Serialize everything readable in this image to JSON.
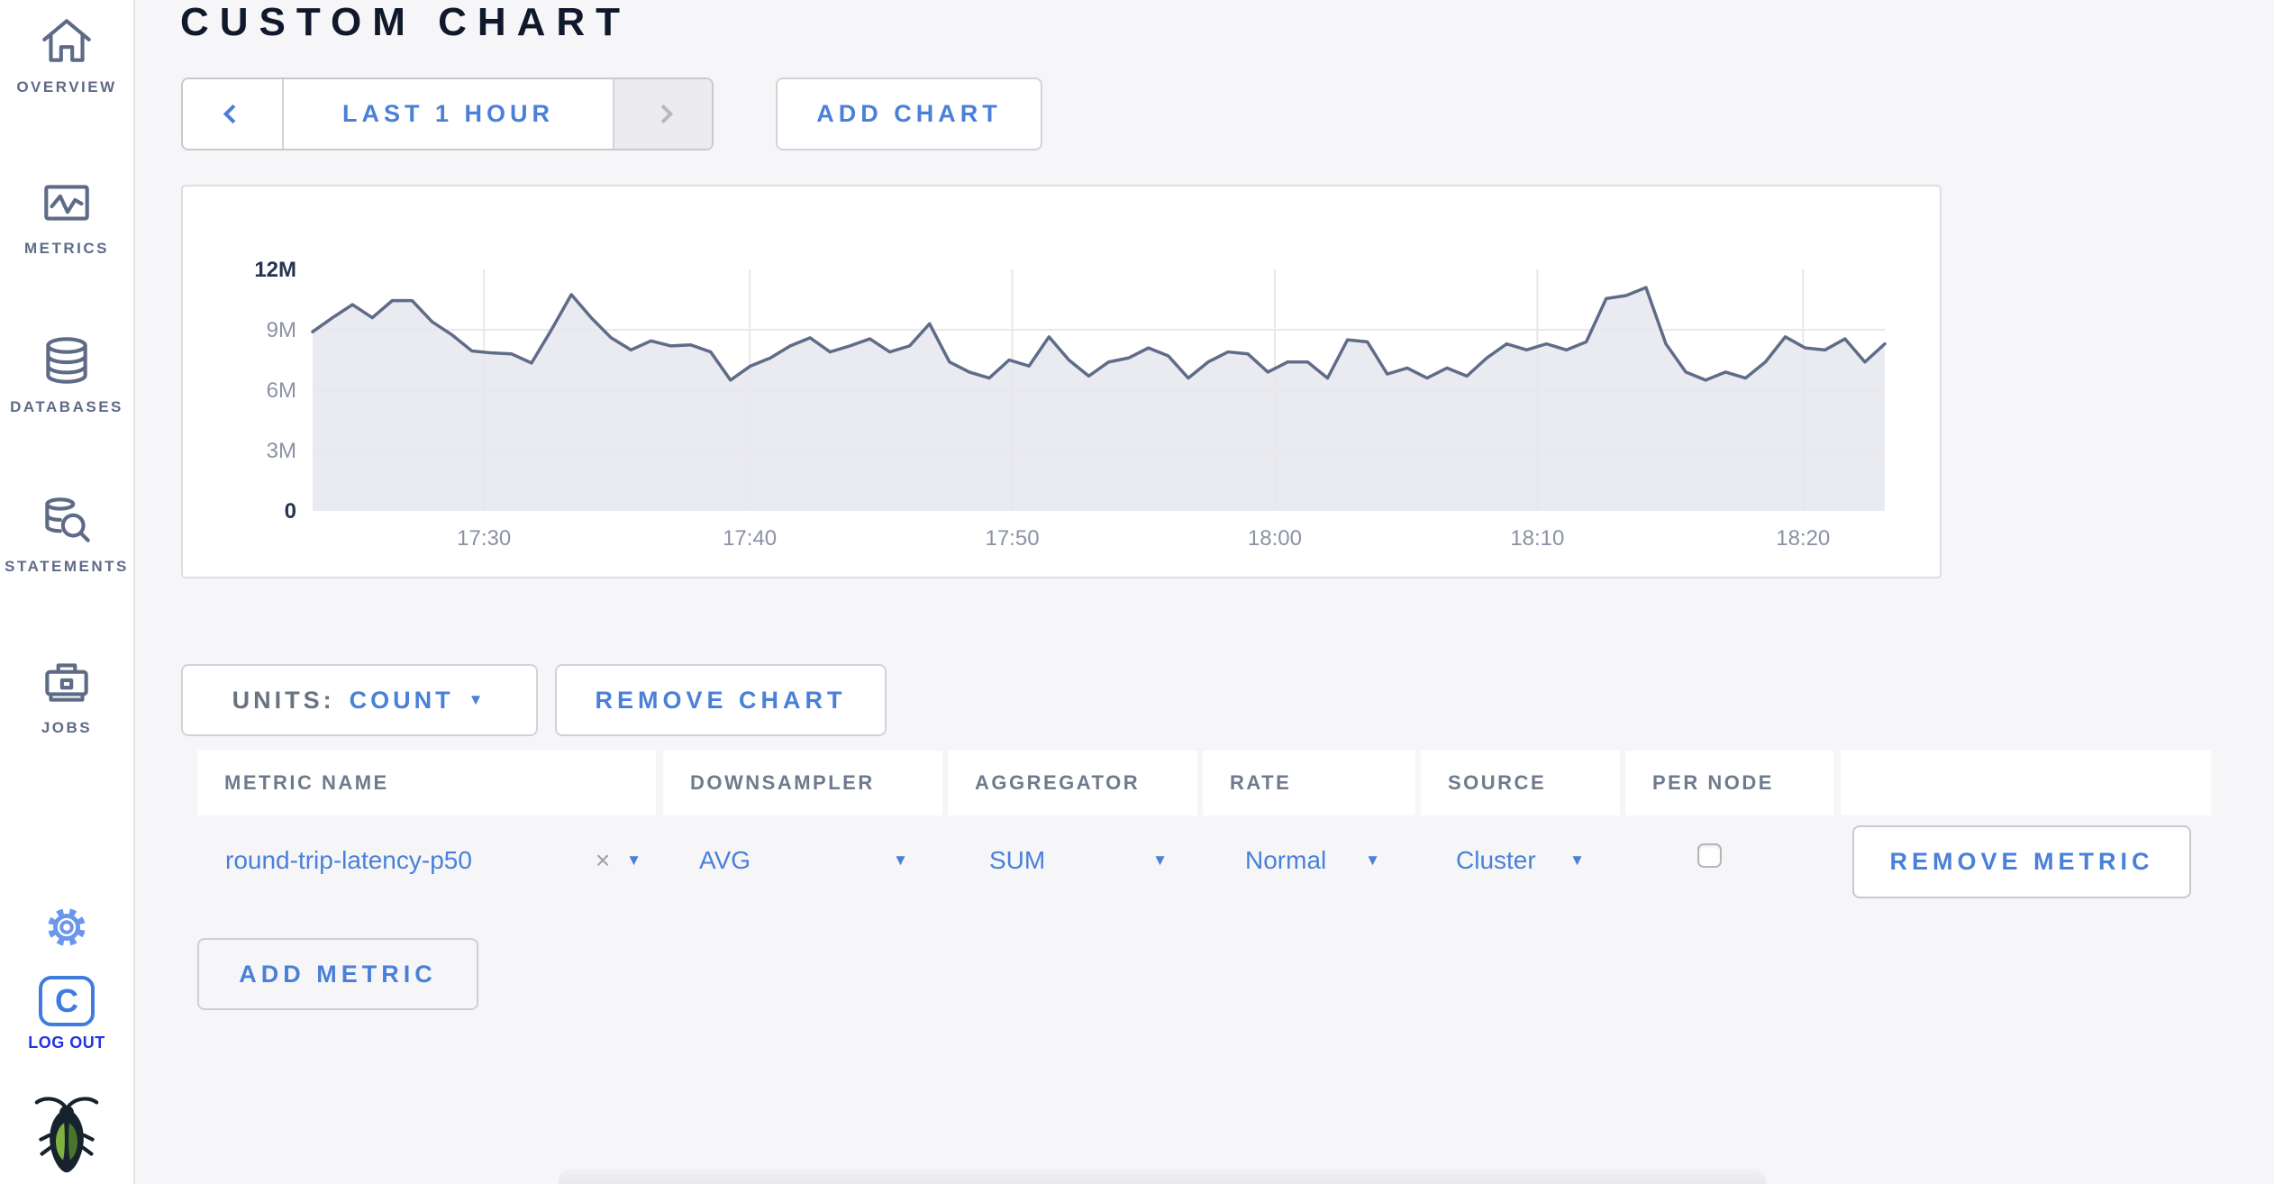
{
  "app": {
    "title": "CUSTOM CHART"
  },
  "sidebar": {
    "items": [
      {
        "label": "OVERVIEW",
        "icon": "home-icon"
      },
      {
        "label": "METRICS",
        "icon": "metrics-icon"
      },
      {
        "label": "DATABASES",
        "icon": "database-icon"
      },
      {
        "label": "STATEMENTS",
        "icon": "statements-icon"
      },
      {
        "label": "JOBS",
        "icon": "jobs-icon"
      }
    ],
    "logout_label": "LOG OUT"
  },
  "toolbar": {
    "time_range_label": "LAST 1 HOUR",
    "add_chart_label": "ADD CHART"
  },
  "chart_controls": {
    "units_label": "UNITS:",
    "units_value": "COUNT",
    "remove_chart_label": "REMOVE CHART",
    "remove_metric_label": "REMOVE METRIC",
    "add_metric_label": "ADD METRIC"
  },
  "metric_table": {
    "headers": [
      "METRIC NAME",
      "DOWNSAMPLER",
      "AGGREGATOR",
      "RATE",
      "SOURCE",
      "PER NODE"
    ],
    "rows": [
      {
        "metric_name": "round-trip-latency-p50",
        "clear_symbol": "×",
        "downsampler": "AVG",
        "aggregator": "SUM",
        "rate": "Normal",
        "source": "Cluster",
        "per_node_checked": false
      }
    ]
  },
  "chart_data": {
    "type": "area",
    "title": "",
    "xlabel": "",
    "ylabel": "count",
    "ylim_m": [
      0,
      12
    ],
    "ymax_m": 12,
    "grid": true,
    "legend": "none",
    "line_color": "#5f6c87",
    "fill_color": "#e9ebf1",
    "grid_color": "#e8e8eb",
    "axis_label_gray": "#8b92a5",
    "axis_label_dark": "#263352",
    "y_ticks": [
      {
        "label": "0",
        "value_m": 0
      },
      {
        "label": "3M",
        "value_m": 3
      },
      {
        "label": "6M",
        "value_m": 6
      },
      {
        "label": "9M",
        "value_m": 9
      },
      {
        "label": "12M",
        "value_m": 12
      }
    ],
    "x_ticks": [
      {
        "label": "17:30",
        "frac": 0.109
      },
      {
        "label": "17:40",
        "frac": 0.278
      },
      {
        "label": "17:50",
        "frac": 0.445
      },
      {
        "label": "18:00",
        "frac": 0.612
      },
      {
        "label": "18:10",
        "frac": 0.779
      },
      {
        "label": "18:20",
        "frac": 0.948
      }
    ],
    "series": [
      {
        "name": "round-trip-latency-p50",
        "values_m": [
          8.9,
          9.6,
          10.25,
          9.6,
          10.45,
          10.45,
          9.4,
          8.75,
          7.95,
          7.85,
          7.8,
          7.35,
          9.0,
          10.75,
          9.6,
          8.6,
          8.0,
          8.45,
          8.2,
          8.25,
          7.9,
          6.5,
          7.2,
          7.6,
          8.2,
          8.6,
          7.9,
          8.2,
          8.55,
          7.9,
          8.2,
          9.3,
          7.4,
          6.9,
          6.6,
          7.5,
          7.2,
          8.65,
          7.5,
          6.7,
          7.4,
          7.6,
          8.1,
          7.7,
          6.6,
          7.4,
          7.9,
          7.8,
          6.9,
          7.4,
          7.4,
          6.6,
          8.5,
          8.4,
          6.8,
          7.1,
          6.6,
          7.1,
          6.7,
          7.6,
          8.3,
          8.0,
          8.3,
          8.0,
          8.4,
          10.55,
          10.7,
          11.1,
          8.3,
          6.9,
          6.5,
          6.9,
          6.6,
          7.4,
          8.65,
          8.1,
          8.0,
          8.55,
          7.4,
          8.3
        ]
      }
    ]
  },
  "colors": {
    "accent_blue": "#4a80d8",
    "logout_blue": "#2433de",
    "sidebar_slate": "#5e6b86",
    "title_dark": "#10192c",
    "page_bg": "#f6f6f8",
    "card_border": "#dedee2"
  }
}
